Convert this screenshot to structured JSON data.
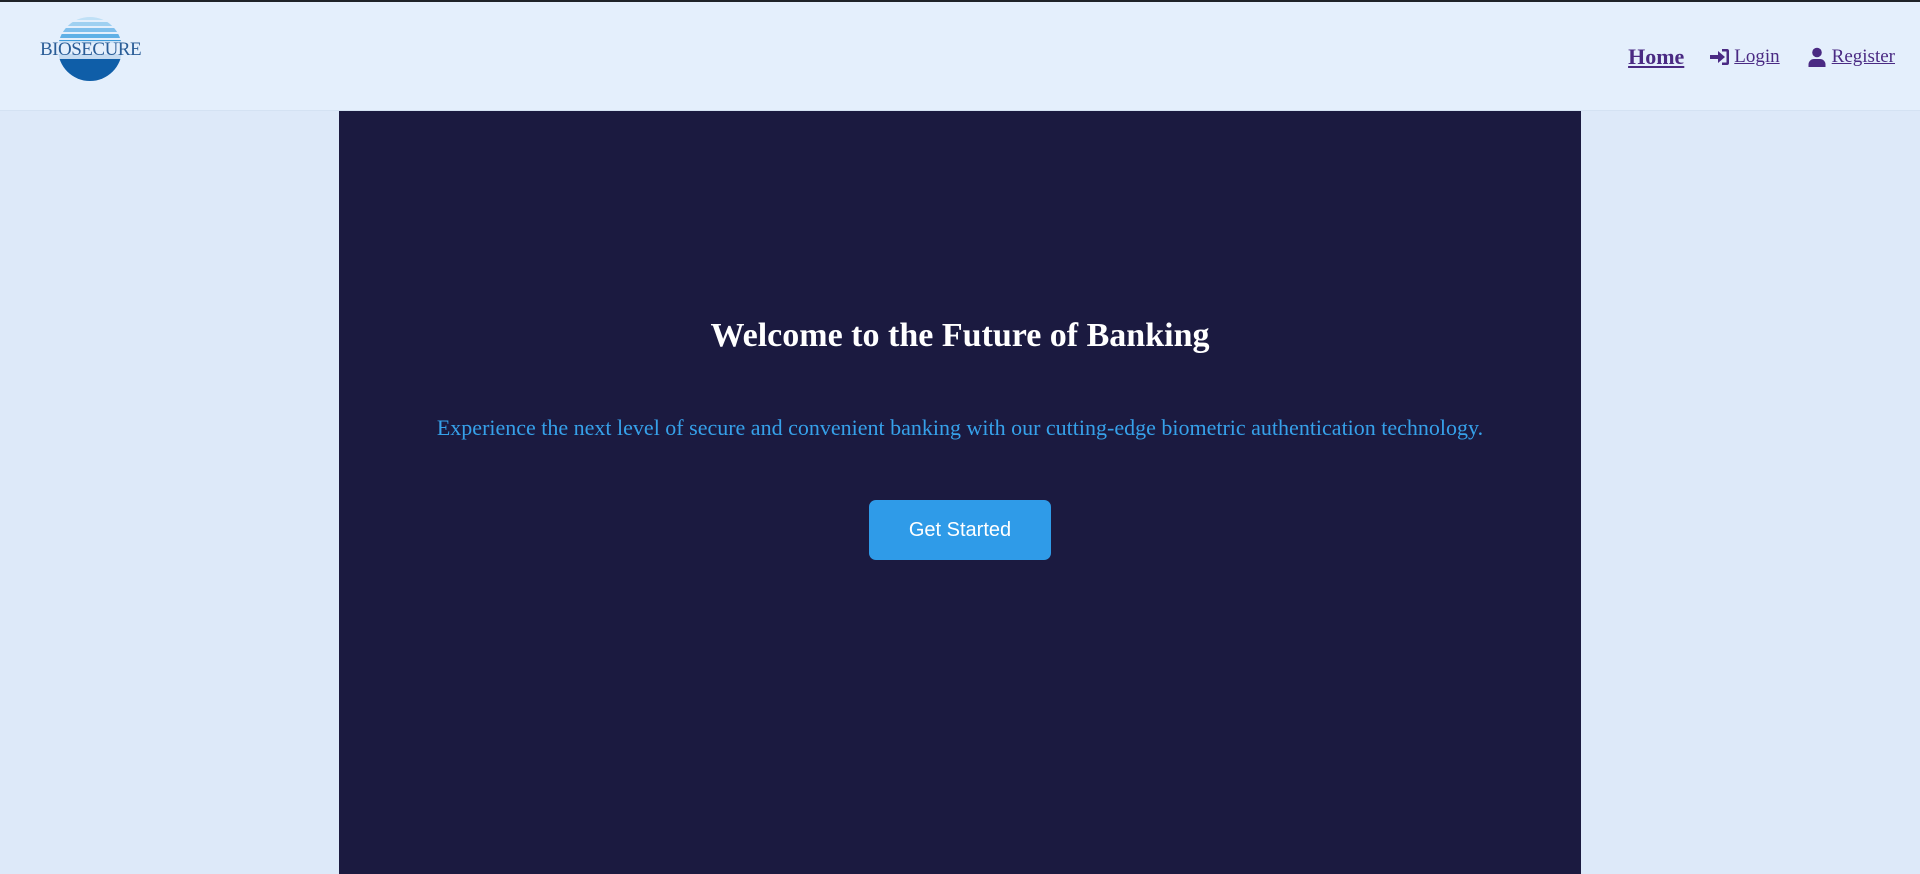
{
  "brand": {
    "logo_text": "BIOSECURE",
    "colors": {
      "logo_light": "#8ec6ee",
      "logo_mid": "#3d9ad9",
      "logo_dark": "#0f5ea8"
    }
  },
  "nav": {
    "items": [
      {
        "label": "Home",
        "icon": null
      },
      {
        "label": "Login",
        "icon": "sign-in-icon"
      },
      {
        "label": "Register",
        "icon": "user-icon"
      }
    ],
    "link_color": "#4a2a83"
  },
  "hero": {
    "title": "Welcome to the Future of Banking",
    "subtitle": "Experience the next level of secure and convenient banking with our cutting-edge biometric authentication technology.",
    "cta_label": "Get Started",
    "background": "#1b1a40",
    "accent": "#2f9be8"
  },
  "page": {
    "background": "#dde9f9",
    "header_background": "#e4effc"
  }
}
